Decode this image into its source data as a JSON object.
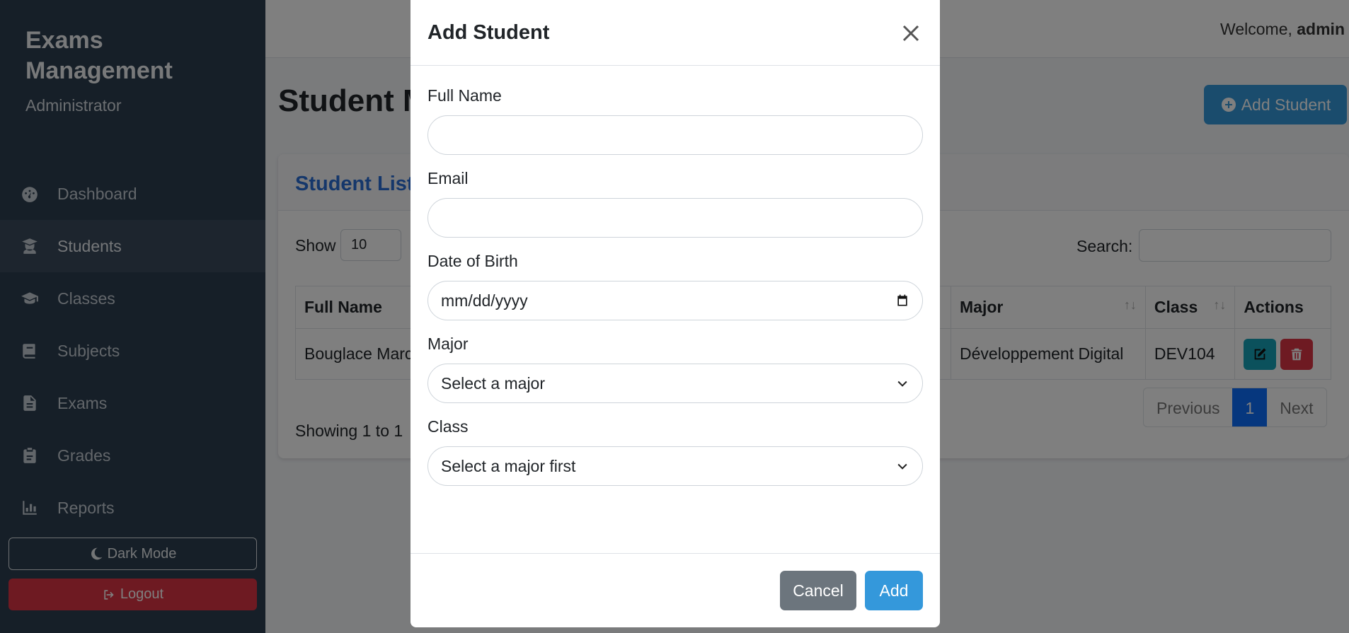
{
  "sidebar": {
    "brand_title": "Exams Management",
    "role": "Administrator",
    "items": [
      {
        "label": "Dashboard",
        "icon": "dashboard-icon"
      },
      {
        "label": "Students",
        "icon": "student-icon"
      },
      {
        "label": "Classes",
        "icon": "graduation-cap-icon"
      },
      {
        "label": "Subjects",
        "icon": "book-icon"
      },
      {
        "label": "Exams",
        "icon": "file-icon"
      },
      {
        "label": "Grades",
        "icon": "clipboard-icon"
      },
      {
        "label": "Reports",
        "icon": "chart-icon"
      }
    ],
    "dark_mode_label": "Dark Mode",
    "logout_label": "Logout"
  },
  "topbar": {
    "welcome_prefix": "Welcome, ",
    "username": "admin"
  },
  "page": {
    "title": "Student M",
    "add_button_label": "Add Student"
  },
  "card": {
    "title": "Student List",
    "show_label": "Show",
    "page_size": "10",
    "search_label": "Search:",
    "columns": [
      "Full Name",
      "Major",
      "Class",
      "Actions"
    ],
    "rows": [
      {
        "full_name": "Bouglace Marc",
        "major": "Développement Digital",
        "class": "DEV104"
      }
    ],
    "showing_text": "Showing 1 to 1",
    "pager": {
      "previous": "Previous",
      "current": "1",
      "next": "Next"
    }
  },
  "modal": {
    "title": "Add Student",
    "fields": {
      "full_name_label": "Full Name",
      "email_label": "Email",
      "dob_label": "Date of Birth",
      "dob_placeholder": "mm/dd/yyyy",
      "major_label": "Major",
      "major_value": "Select a major",
      "class_label": "Class",
      "class_value": "Select a major first"
    },
    "cancel_label": "Cancel",
    "add_label": "Add"
  },
  "colors": {
    "sidebar_bg": "#2c3e50",
    "primary": "#3498db",
    "danger": "#dc3545",
    "info": "#17a2b8",
    "secondary": "#6c757d"
  }
}
